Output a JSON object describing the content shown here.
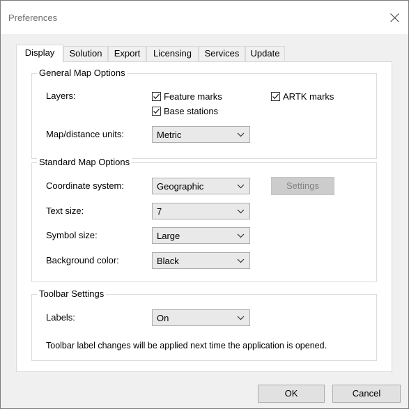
{
  "window": {
    "title": "Preferences"
  },
  "tabs": [
    {
      "label": "Display"
    },
    {
      "label": "Solution"
    },
    {
      "label": "Export"
    },
    {
      "label": "Licensing"
    },
    {
      "label": "Services"
    },
    {
      "label": "Update"
    }
  ],
  "general": {
    "legend": "General Map Options",
    "layers_label": "Layers:",
    "feature_marks": "Feature marks",
    "artk_marks": "ARTK marks",
    "base_stations": "Base stations",
    "units_label": "Map/distance units:",
    "units_value": "Metric"
  },
  "standard": {
    "legend": "Standard Map Options",
    "coord_label": "Coordinate system:",
    "coord_value": "Geographic",
    "settings_button": "Settings",
    "text_size_label": "Text size:",
    "text_size_value": "7",
    "symbol_size_label": "Symbol size:",
    "symbol_size_value": "Large",
    "bg_color_label": "Background color:",
    "bg_color_value": "Black"
  },
  "toolbar": {
    "legend": "Toolbar Settings",
    "labels_label": "Labels:",
    "labels_value": "On",
    "note": "Toolbar label changes will be applied next time the application is opened."
  },
  "footer": {
    "ok": "OK",
    "cancel": "Cancel"
  }
}
